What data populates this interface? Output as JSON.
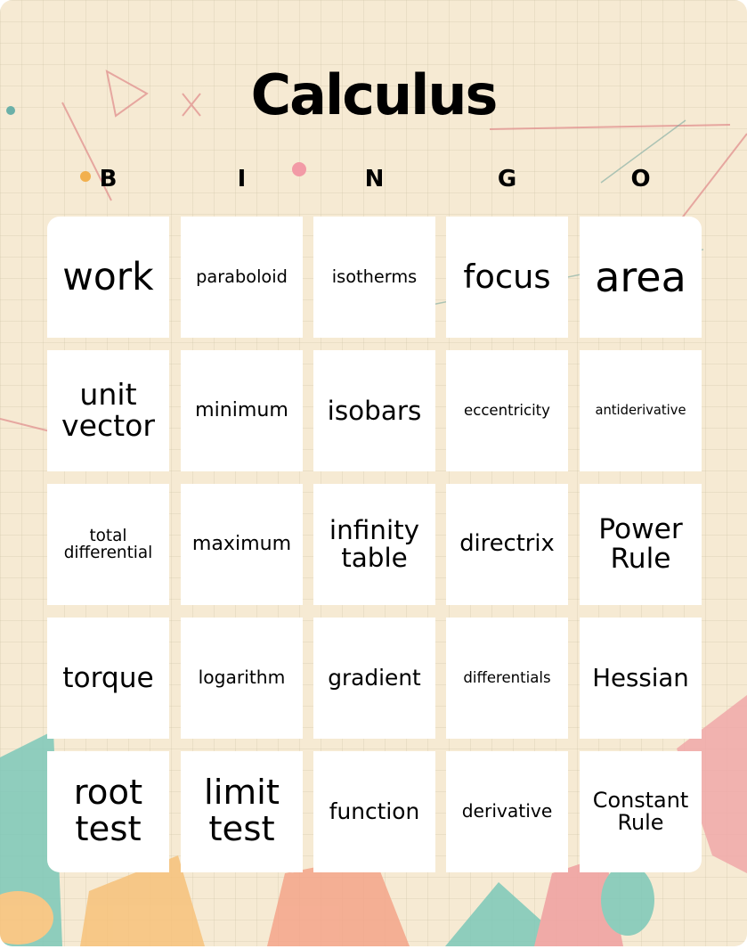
{
  "title": "Calculus",
  "header_letters": [
    "B",
    "I",
    "N",
    "G",
    "O"
  ],
  "cells": [
    [
      {
        "text": "work",
        "size": 46
      },
      {
        "text": "paraboloid",
        "size": 21
      },
      {
        "text": "isotherms",
        "size": 21
      },
      {
        "text": "focus",
        "size": 40
      },
      {
        "text": "area",
        "size": 50
      }
    ],
    [
      {
        "text": "unit vector",
        "size": 36
      },
      {
        "text": "minimum",
        "size": 24
      },
      {
        "text": "isobars",
        "size": 32
      },
      {
        "text": "eccentricity",
        "size": 18
      },
      {
        "text": "antiderivative",
        "size": 16
      }
    ],
    [
      {
        "text": "total differential",
        "size": 20
      },
      {
        "text": "maximum",
        "size": 24
      },
      {
        "text": "infinity table",
        "size": 32
      },
      {
        "text": "directrix",
        "size": 28
      },
      {
        "text": "Power Rule",
        "size": 34
      }
    ],
    [
      {
        "text": "torque",
        "size": 34
      },
      {
        "text": "logarithm",
        "size": 22
      },
      {
        "text": "gradient",
        "size": 27
      },
      {
        "text": "differentials",
        "size": 18
      },
      {
        "text": "Hessian",
        "size": 30
      }
    ],
    [
      {
        "text": "root test",
        "size": 42
      },
      {
        "text": "limit test",
        "size": 42
      },
      {
        "text": "function",
        "size": 27
      },
      {
        "text": "derivative",
        "size": 22
      },
      {
        "text": "Constant Rule",
        "size": 26
      }
    ]
  ],
  "colors": {
    "background": "#f6ead3",
    "cell": "#ffffff",
    "text": "#000000",
    "accent_teal": "#7cc8b8",
    "accent_pink": "#f0a0a0",
    "accent_orange": "#f7c27a"
  }
}
